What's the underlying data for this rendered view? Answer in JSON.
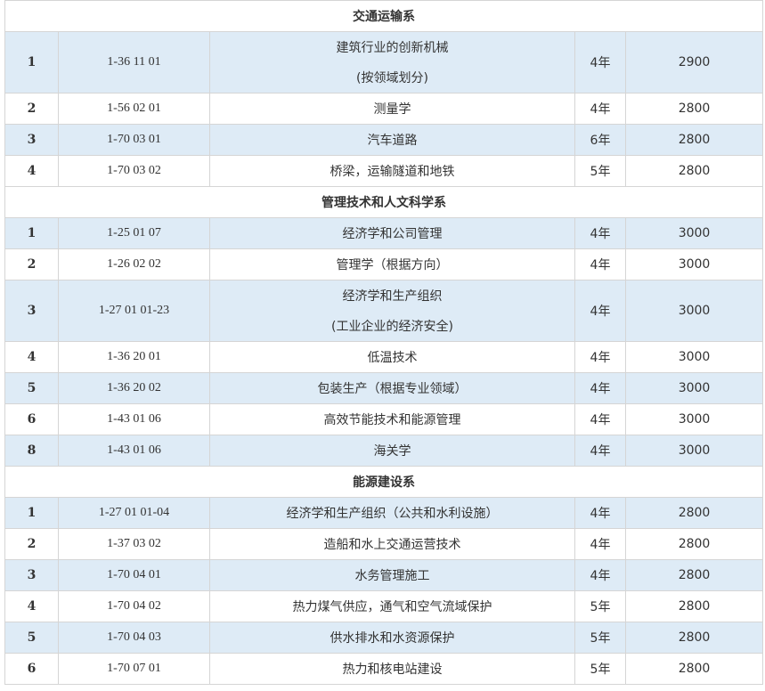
{
  "sections": [
    {
      "title": "交通运输系",
      "rows": [
        {
          "num": "1",
          "code": "1-36 11 01",
          "name": "建筑行业的创新机械",
          "name2": "(按领域划分)",
          "duration": "4年",
          "fee": "2900"
        },
        {
          "num": "2",
          "code": "1-56 02 01",
          "name": "测量学",
          "name2": "",
          "duration": "4年",
          "fee": "2800"
        },
        {
          "num": "3",
          "code": "1-70 03 01",
          "name": "汽车道路",
          "name2": "",
          "duration": "6年",
          "fee": "2800"
        },
        {
          "num": "4",
          "code": "1-70 03 02",
          "name": "桥梁，运输隧道和地铁",
          "name2": "",
          "duration": "5年",
          "fee": "2800"
        }
      ]
    },
    {
      "title": "管理技术和人文科学系",
      "rows": [
        {
          "num": "1",
          "code": "1-25 01 07",
          "name": "经济学和公司管理",
          "name2": "",
          "duration": "4年",
          "fee": "3000"
        },
        {
          "num": "2",
          "code": "1-26 02 02",
          "name": "管理学（根据方向）",
          "name2": "",
          "duration": "4年",
          "fee": "3000"
        },
        {
          "num": "3",
          "code": "1-27 01 01-23",
          "name": "经济学和生产组织",
          "name2": "(工业企业的经济安全)",
          "duration": "4年",
          "fee": "3000"
        },
        {
          "num": "4",
          "code": "1-36 20 01",
          "name": "低温技术",
          "name2": "",
          "duration": "4年",
          "fee": "3000"
        },
        {
          "num": "5",
          "code": "1-36 20 02",
          "name": "包装生产（根据专业领域）",
          "name2": "",
          "duration": "4年",
          "fee": "3000"
        },
        {
          "num": "6",
          "code": "1-43 01 06",
          "name": "高效节能技术和能源管理",
          "name2": "",
          "duration": "4年",
          "fee": "3000"
        },
        {
          "num": "8",
          "code": "1-43 01 06",
          "name": "海关学",
          "name2": "",
          "duration": "4年",
          "fee": "3000"
        }
      ]
    },
    {
      "title": "能源建设系",
      "rows": [
        {
          "num": "1",
          "code": "1-27 01 01-04",
          "name": "经济学和生产组织（公共和水利设施）",
          "name2": "",
          "duration": "4年",
          "fee": "2800"
        },
        {
          "num": "2",
          "code": "1-37 03 02",
          "name": "造船和水上交通运营技术",
          "name2": "",
          "duration": "4年",
          "fee": "2800"
        },
        {
          "num": "3",
          "code": "1-70 04 01",
          "name": "水务管理施工",
          "name2": "",
          "duration": "4年",
          "fee": "2800"
        },
        {
          "num": "4",
          "code": "1-70 04 02",
          "name": "热力煤气供应，通气和空气流域保护",
          "name2": "",
          "duration": "5年",
          "fee": "2800"
        },
        {
          "num": "5",
          "code": "1-70 04 03",
          "name": "供水排水和水资源保护",
          "name2": "",
          "duration": "5年",
          "fee": "2800"
        },
        {
          "num": "6",
          "code": "1-70 07 01",
          "name": "热力和核电站建设",
          "name2": "",
          "duration": "5年",
          "fee": "2800"
        }
      ]
    }
  ]
}
